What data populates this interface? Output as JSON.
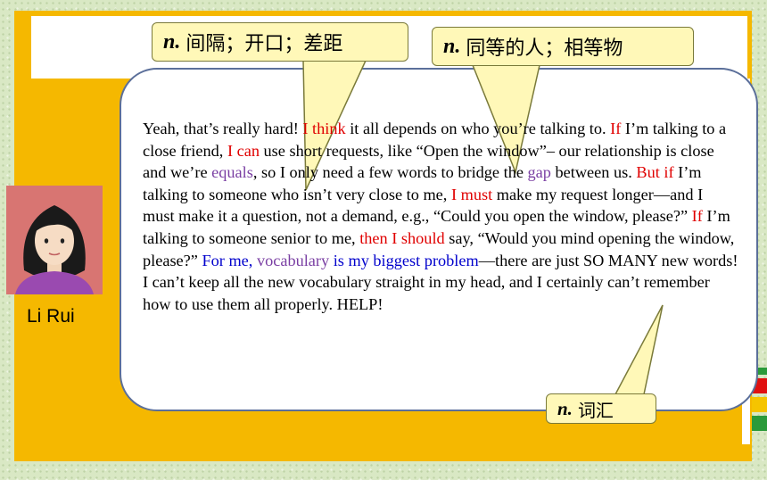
{
  "callouts": {
    "gap": {
      "pos": "n.",
      "meaning": "间隔；开口；差距"
    },
    "equal": {
      "pos": "n.",
      "meaning": "同等的人；相等物"
    },
    "vocab": {
      "pos": "n.",
      "meaning": "词汇"
    }
  },
  "speaker": {
    "name": "Li Rui"
  },
  "passage": {
    "s1": "Yeah, that’s really hard! ",
    "s2": "I think",
    "s3": " it all depends on who you’re talking to. ",
    "s4": "If",
    "s5": " I’m talking to a close friend, ",
    "s6": "I can",
    "s7": " use short requests, like “Open the window”– our relationship is close and we’re ",
    "s8": "equals",
    "s9": ", so I only need a few words to bridge the ",
    "s10": "gap",
    "s11": " between us. ",
    "s12": "But if",
    "s13": " I’m talking to someone who isn’t very close to me, ",
    "s14": "I must",
    "s15": " make my request longer—and I must make it a question, not a demand, e.g., “Could you open the window, please?” ",
    "s16": "If",
    "s17": " I’m talking to someone senior to me, ",
    "s18": "then I should",
    "s19": " say, “Would you mind opening the window, please?” ",
    "s20": "For me, ",
    "s21": "vocabulary",
    "s22": " is my biggest problem",
    "s23": "—there are just SO MANY new words! I can’t keep all the new vocabulary straight in my head, and I certainly can’t remember how to use them all properly. HELP!"
  },
  "colors": {
    "orange_panel": "#f5b800",
    "highlight_red": "#e00000",
    "highlight_purple": "#7a3fa3",
    "highlight_blue": "#0000cc",
    "callout_fill": "#fff8b8",
    "tab_red": "#e01010",
    "tab_yellow": "#f5c400",
    "tab_green": "#2a9a3a"
  }
}
